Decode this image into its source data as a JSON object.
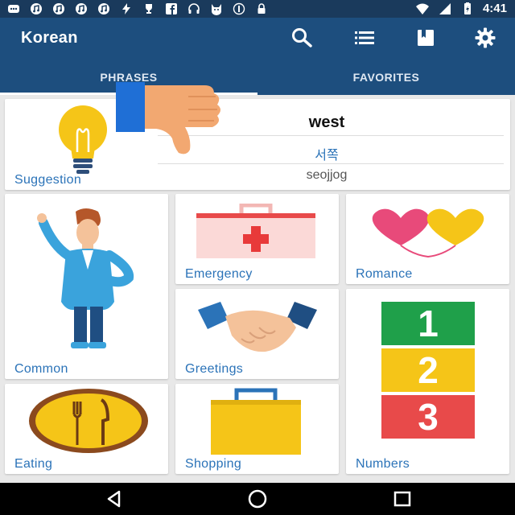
{
  "status_bar": {
    "time": "4:41",
    "icons": [
      "message-icon",
      "music-icon",
      "music-icon",
      "music-icon",
      "music-icon",
      "bolt-icon",
      "trophy-icon",
      "facebook-icon",
      "headphones-icon",
      "cat-icon",
      "copyright-icon",
      "lock-icon",
      "wifi-icon",
      "battery-icon"
    ]
  },
  "app_bar": {
    "title": "Korean",
    "actions": [
      "search-icon",
      "list-icon",
      "book-icon",
      "settings-icon"
    ]
  },
  "tabs": [
    {
      "label": "PHRASES",
      "selected": true
    },
    {
      "label": "FAVORITES",
      "selected": false
    }
  ],
  "suggestion": {
    "label": "Suggestion",
    "word": "west",
    "korean": "서쪽",
    "romanization": "seojjog"
  },
  "categories": [
    {
      "label": "Common",
      "icon": "person-icon"
    },
    {
      "label": "Emergency",
      "icon": "first-aid-kit-icon"
    },
    {
      "label": "Romance",
      "icon": "hearts-icon"
    },
    {
      "label": "Greetings",
      "icon": "handshake-icon"
    },
    {
      "label": "Numbers",
      "icon": "numbers-icon"
    },
    {
      "label": "Eating",
      "icon": "plate-icon"
    },
    {
      "label": "Shopping",
      "icon": "shopping-bag-icon"
    }
  ],
  "numbers_tiles": [
    "1",
    "2",
    "3"
  ],
  "colors": {
    "app_bar": "#1d4e7e",
    "accent_label": "#2b73b8"
  },
  "overlay": {
    "icon": "thumbs-down-icon"
  }
}
